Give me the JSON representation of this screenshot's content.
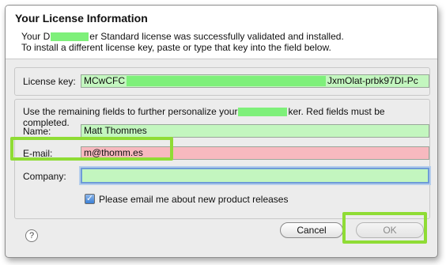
{
  "dialog": {
    "title": "Your License Information",
    "message_line1_prefix": "Your ",
    "message_line1_mid": "D",
    "message_line1_suffix": "er Standard license was successfully validated and installed.",
    "message_line2": "To install a different license key, paste or type that key into the field below."
  },
  "license": {
    "label": "License key:",
    "value_prefix": "MCwCFC",
    "value_suffix": "JxmOlat-prbk97DI-Pc"
  },
  "personalize": {
    "hint_prefix": "Use the remaining fields to further personalize your",
    "hint_suffix": "ker. Red fields must be completed."
  },
  "form": {
    "name_label": "Name:",
    "name_value": "Matt Thommes",
    "email_label": "E-mail:",
    "email_value": "m@thomm.es",
    "company_label": "Company:",
    "company_value": "",
    "newsletter_label": "Please email me about new product releases",
    "newsletter_checked": true
  },
  "footer": {
    "help_glyph": "?",
    "cancel_label": "Cancel",
    "ok_label": "OK"
  },
  "colors": {
    "valid_field": "#c3f6bf",
    "invalid_field": "#f7b9bf",
    "highlight": "#8fdc35",
    "redaction": "#7ef07a"
  }
}
